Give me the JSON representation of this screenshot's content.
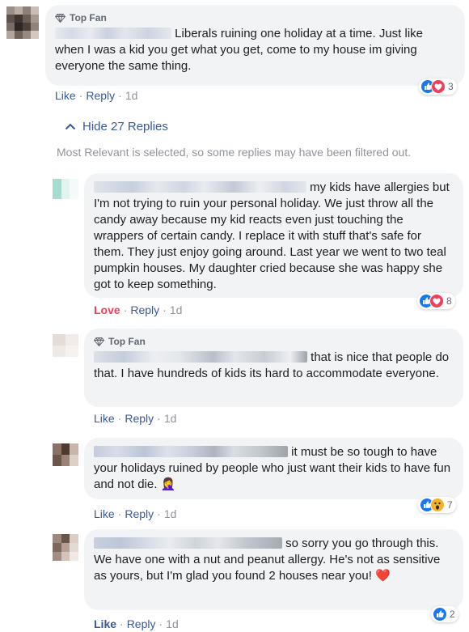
{
  "colors": {
    "link": "#385898",
    "love": "#f33e58",
    "muted": "#90949c",
    "bubble": "#f2f3f5"
  },
  "comment": {
    "badge": "Top Fan",
    "text": "Liberals ruining one holiday at a time. Just like when I was a kid you get what you get, come to my house im giving everyone the same thing.",
    "reactions": [
      "like",
      "love"
    ],
    "reaction_count": "3",
    "like_label": "Like",
    "reply_label": "Reply",
    "time": "1d"
  },
  "hide_replies_label": "Hide 27 Replies",
  "filter_note": "Most Relevant is selected, so some replies may have been filtered out.",
  "replies": [
    {
      "text": "my kids have allergies but I'm not trying to ruin your personal holiday. We just throw all the candy away because my kid reacts even just touching the wrappers of certain candy. I replace it with stuff that's safe for them. They just enjoy going around. Last year we went to two teal pumpkin houses. My daughter cried because she was happy she got to keep something.",
      "reactions": [
        "like",
        "love"
      ],
      "reaction_count": "8",
      "reacted_label": "Love",
      "reply_label": "Reply",
      "time": "1d"
    },
    {
      "badge": "Top Fan",
      "text": "that is nice that people do that. I have hundreds of kids its hard to accommodate everyone.",
      "like_label": "Like",
      "reply_label": "Reply",
      "time": "1d"
    },
    {
      "text": "it must be so tough to have your holidays ruined by people who just want their kids to have fun and not die. 🤦‍♀️",
      "reactions": [
        "like",
        "wow"
      ],
      "reaction_count": "7",
      "like_label": "Like",
      "reply_label": "Reply",
      "time": "1d"
    },
    {
      "text": "so sorry you go through this. We have one with a nut and peanut allergy. He's not as sensitive as yours, but I'm glad you found 2 houses near you! ❤️",
      "reactions": [
        "like"
      ],
      "reaction_count": "2",
      "reacted_label": "Like",
      "reply_label": "Reply",
      "time": "1d"
    }
  ]
}
